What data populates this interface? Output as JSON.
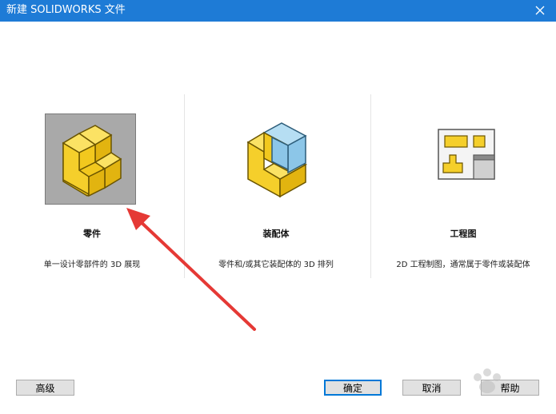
{
  "window": {
    "title": "新建 SOLIDWORKS 文件"
  },
  "templates": [
    {
      "title": "零件",
      "description": "单一设计零部件的 3D 展现",
      "icon": "part-icon",
      "selected": true
    },
    {
      "title": "装配体",
      "description": "零件和/或其它装配体的 3D 排列",
      "icon": "assembly-icon",
      "selected": false
    },
    {
      "title": "工程图",
      "description": "2D 工程制图，通常属于零件或装配体",
      "icon": "drawing-icon",
      "selected": false
    }
  ],
  "buttons": {
    "advanced": "高级",
    "ok": "确定",
    "cancel": "取消",
    "help": "帮助"
  },
  "colors": {
    "titlebar": "#1e7bd6",
    "selection": "#a9a9a9",
    "part_yellow": "#f5cf2b",
    "assembly_blue": "#8cc6e8",
    "annotation_arrow": "#e53935"
  }
}
